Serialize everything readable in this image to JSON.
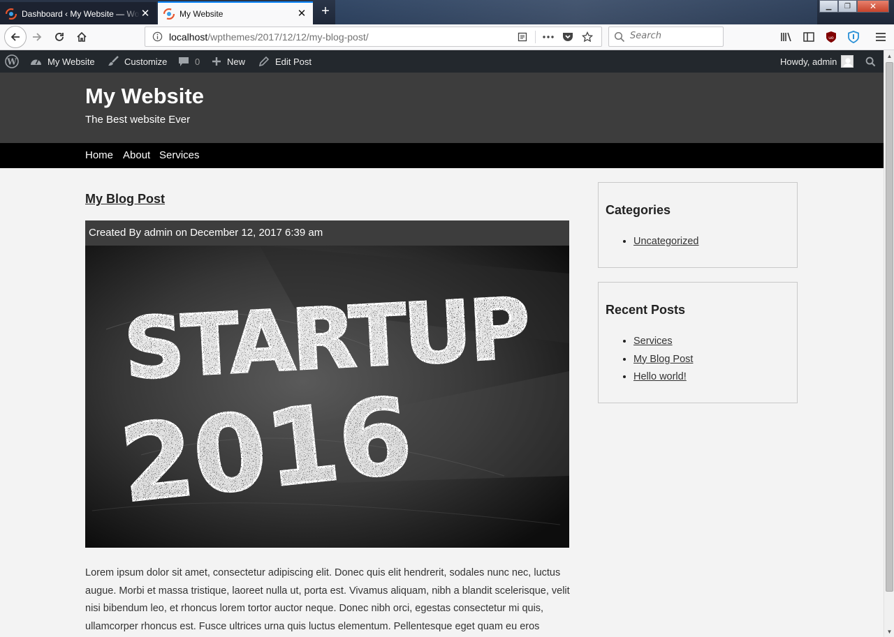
{
  "browser": {
    "tabs": [
      {
        "title": "Dashboard ‹ My Website — WordPress",
        "active": false
      },
      {
        "title": "My Website",
        "active": true
      }
    ],
    "tab_close_glyph": "✕",
    "new_tab_glyph": "+",
    "url_host": "localhost",
    "url_path": "/wpthemes/2017/12/12/my-blog-post/",
    "search_placeholder": "Search",
    "accent_color": "#0a84ff"
  },
  "admin_bar": {
    "site_name": "My Website",
    "customize": "Customize",
    "comments_count": "0",
    "new_label": "New",
    "edit_post": "Edit Post",
    "greeting": "Howdy, admin",
    "bg_color": "#23282d"
  },
  "site": {
    "title": "My Website",
    "tagline": "The Best website Ever",
    "menu": [
      "Home",
      "About",
      "Services"
    ]
  },
  "post": {
    "title": "My Blog Post",
    "meta": "Created By admin on December 12, 2017 6:39 am",
    "image_text_line1": "STARTUP",
    "image_text_line2": "2016",
    "body": "Lorem ipsum dolor sit amet, consectetur adipiscing elit. Donec quis elit hendrerit, sodales nunc nec, luctus augue. Morbi et massa tristique, laoreet nulla ut, porta est. Vivamus aliquam, nibh a blandit scelerisque, velit nisi bibendum leo, et rhoncus lorem tortor auctor neque. Donec nibh orci, egestas consectetur mi quis, ullamcorper rhoncus est. Fusce ultrices urna quis luctus elementum. Pellentesque eget quam eu eros"
  },
  "sidebar": {
    "categories": {
      "heading": "Categories",
      "items": [
        "Uncategorized"
      ]
    },
    "recent_posts": {
      "heading": "Recent Posts",
      "items": [
        "Services",
        "My Blog Post",
        "Hello world!"
      ]
    }
  }
}
